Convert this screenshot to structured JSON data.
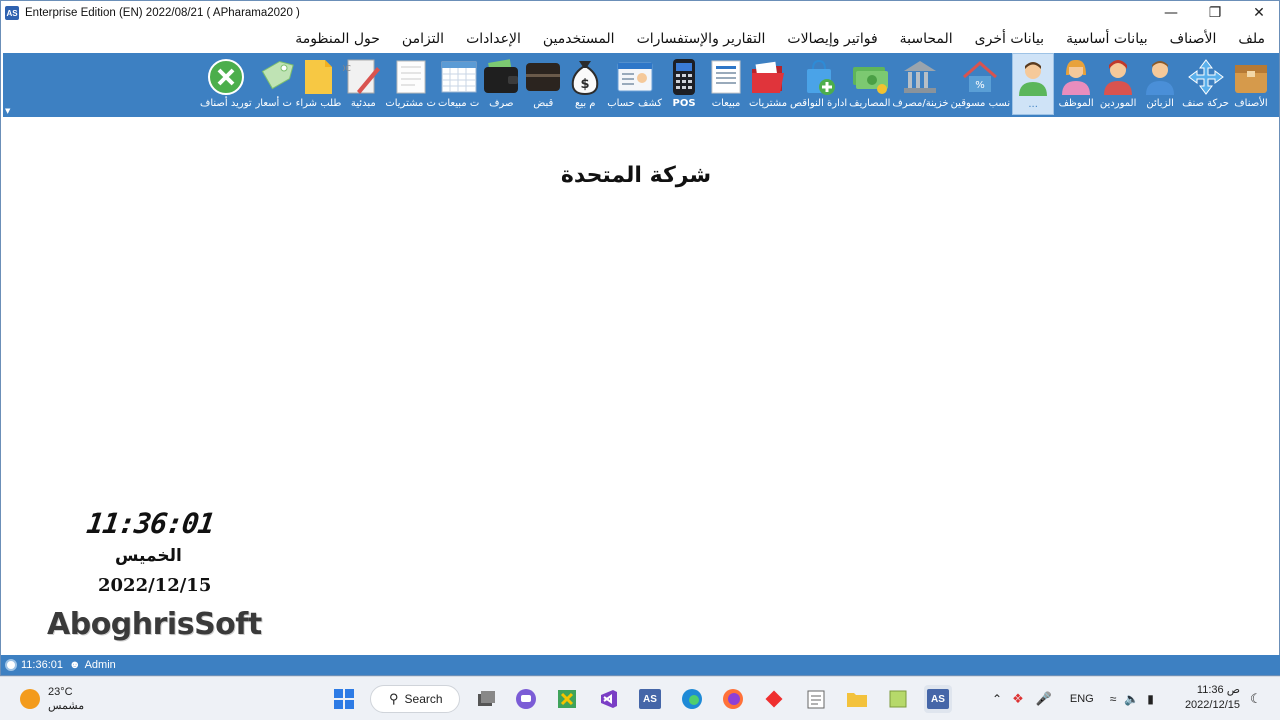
{
  "window": {
    "app_icon_text": "AS",
    "title": "Enterprise Edition (EN) 2022/08/21  ( APharama2020 )"
  },
  "menu": [
    "ملف",
    "الأصناف",
    "بيانات أساسية",
    "بيانات أخرى",
    "المحاسبة",
    "فواتير وإيصالات",
    "التقارير والإستفسارات",
    "المستخدمين",
    "الإعدادات",
    "التزامن",
    "حول المنظومة"
  ],
  "toolbar": [
    {
      "label": "الأصناف",
      "icon": "box-icon"
    },
    {
      "label": "حركة صنف",
      "icon": "move-arrows-icon"
    },
    {
      "label": "الزبائن",
      "icon": "customer-icon"
    },
    {
      "label": "الموردين",
      "icon": "supplier-icon"
    },
    {
      "label": "الموظف",
      "icon": "employee-icon"
    },
    {
      "label": "...",
      "icon": "user-green-icon",
      "selected": true
    },
    {
      "label": "نسب مسوقين",
      "icon": "house-percent-icon"
    },
    {
      "label": "خزينة/مصرف",
      "icon": "bank-icon"
    },
    {
      "label": "المصاريف",
      "icon": "money-icon"
    },
    {
      "label": "ادارة النواقص",
      "icon": "shopping-bag-plus-icon"
    },
    {
      "label": "مشتريات",
      "icon": "folder-icon"
    },
    {
      "label": "مبيعات",
      "icon": "sales-doc-icon"
    },
    {
      "label": "POS",
      "icon": "pos-terminal-icon"
    },
    {
      "label": "كشف حساب",
      "icon": "id-card-icon"
    },
    {
      "label": "م بيع",
      "icon": "money-bag-icon"
    },
    {
      "label": "قبض",
      "icon": "wallet-dark-icon"
    },
    {
      "label": "صرف",
      "icon": "wallet-icon"
    },
    {
      "label": "ت مبيعات",
      "icon": "calendar-grid-icon"
    },
    {
      "label": "ت مشتريات",
      "icon": "notepad-icon"
    },
    {
      "label": "مبدئية",
      "icon": "doc-pen-icon"
    },
    {
      "label": "طلب شراء",
      "icon": "yellow-doc-icon"
    },
    {
      "label": "ت أسعار",
      "icon": "price-tag-icon"
    },
    {
      "label": "توريد أصناف",
      "icon": "green-x-icon"
    }
  ],
  "main": {
    "company_name": "شركة المتحدة",
    "clock": "11:36:01",
    "day": "الخميس",
    "date": "2022/12/15",
    "brand": "AboghrisSoft"
  },
  "status": {
    "time": "11:36:01",
    "user": "Admin"
  },
  "taskbar": {
    "temperature": "23°C",
    "weather": "مشمس",
    "search_label": "Search",
    "language": "ENG",
    "time": "11:36 ص",
    "date": "2022/12/15"
  },
  "colors": {
    "toolbar_bg": "#3d80c2",
    "status_bg": "#3d80c2",
    "selected_bg": "#cfe3f7"
  }
}
